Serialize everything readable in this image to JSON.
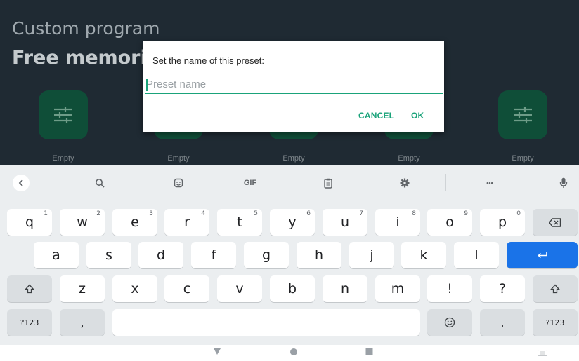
{
  "app": {
    "title": "Custom program",
    "subtitle": "Free memories",
    "presets": [
      {
        "label": "Empty"
      },
      {
        "label": "Empty"
      },
      {
        "label": "Empty"
      },
      {
        "label": "Empty"
      },
      {
        "label": "Empty"
      }
    ]
  },
  "dialog": {
    "message": "Set the name of this preset:",
    "input_placeholder": "Preset name",
    "input_value": "",
    "cancel_label": "CANCEL",
    "ok_label": "OK",
    "accent_color": "#1aa37a"
  },
  "keyboard": {
    "toolbar": {
      "gif_label": "GIF",
      "more_label": "•••"
    },
    "row1": [
      {
        "ch": "q",
        "hint": "1"
      },
      {
        "ch": "w",
        "hint": "2"
      },
      {
        "ch": "e",
        "hint": "3"
      },
      {
        "ch": "r",
        "hint": "4"
      },
      {
        "ch": "t",
        "hint": "5"
      },
      {
        "ch": "y",
        "hint": "6"
      },
      {
        "ch": "u",
        "hint": "7"
      },
      {
        "ch": "i",
        "hint": "8"
      },
      {
        "ch": "o",
        "hint": "9"
      },
      {
        "ch": "p",
        "hint": "0"
      }
    ],
    "row2": [
      "a",
      "s",
      "d",
      "f",
      "g",
      "h",
      "j",
      "k",
      "l"
    ],
    "row3": [
      "z",
      "x",
      "c",
      "v",
      "b",
      "n",
      "m",
      "!",
      "?"
    ],
    "symbols_label": "?123",
    "comma_label": ",",
    "period_label": ".",
    "symbols_label_right": "?123",
    "enter_color": "#1a73e8"
  }
}
